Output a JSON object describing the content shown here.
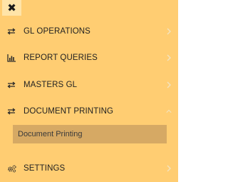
{
  "close_button": {
    "icon": "close-icon",
    "glyph": "✖"
  },
  "menu": {
    "items": [
      {
        "label": "GL OPERATIONS",
        "icon": "arrows-exchange-icon",
        "state": "collapsed"
      },
      {
        "label": "REPORT QUERIES",
        "icon": "bar-chart-icon",
        "state": "collapsed"
      },
      {
        "label": "MASTERS GL",
        "icon": "arrows-exchange-icon",
        "state": "collapsed"
      },
      {
        "label": "DOCUMENT PRINTING",
        "icon": "arrows-exchange-icon",
        "state": "expanded",
        "children": [
          {
            "label": "Document Printing"
          }
        ]
      },
      {
        "label": "SETTINGS",
        "icon": "gears-icon",
        "state": "collapsed"
      }
    ]
  },
  "colors": {
    "panel_background": "#ffcd72",
    "close_button_background": "#ffe4a8",
    "submenu_highlight": "#d6a964",
    "text": "#222222",
    "chevron": "#f3e3c0"
  }
}
